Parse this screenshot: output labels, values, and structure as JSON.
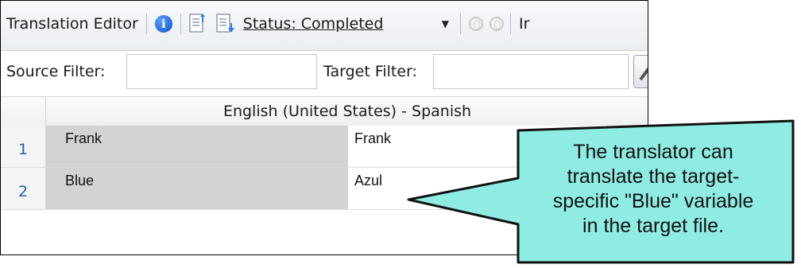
{
  "toolbar": {
    "title": "Translation Editor",
    "status": "Status: Completed",
    "trailing_text": "Ir",
    "icons": [
      "info-icon",
      "export-doc-icon",
      "import-doc-icon",
      "toggle-circles-icon"
    ]
  },
  "filters": {
    "source_label": "Source Filter:",
    "source_value": "",
    "target_label": "Target Filter:",
    "target_value": ""
  },
  "grid": {
    "header": "English (United States) - Spanish",
    "rows": [
      {
        "num": "1",
        "source": "Frank",
        "target": "Frank"
      },
      {
        "num": "2",
        "source": "Blue",
        "target": "Azul"
      }
    ]
  },
  "callout": {
    "lines": [
      "The translator can",
      "translate the target-",
      "specific \"Blue\" variable",
      "in the target file."
    ],
    "color": "#8fece3"
  }
}
